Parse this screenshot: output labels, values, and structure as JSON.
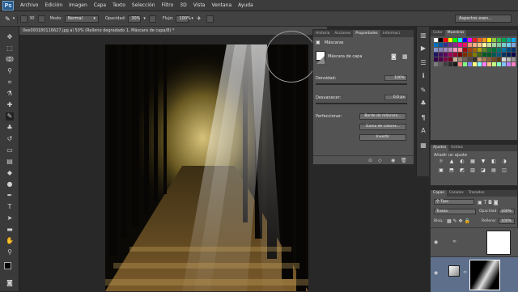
{
  "app": {
    "logo": "Ps"
  },
  "menu": [
    "Archivo",
    "Edición",
    "Imagen",
    "Capa",
    "Texto",
    "Selección",
    "Filtro",
    "3D",
    "Vista",
    "Ventana",
    "Ayuda"
  ],
  "options": {
    "size": "30",
    "mode_label": "Modo:",
    "mode_value": "Normal",
    "opacity_label": "Opacidad:",
    "opacity_value": "30%",
    "flow_label": "Flujo:",
    "flow_value": "100%",
    "workspace": "Aspectos esen..."
  },
  "document": {
    "tab_title": "0ee000180116627.jpg al 50% (Relleno degradado 1, Máscara de capa/8) *"
  },
  "properties": {
    "tabs": [
      "Historia",
      "Acciones",
      "Propiedades",
      "Informaci"
    ],
    "active_tab": 2,
    "section": "Máscaras",
    "mask_label": "Máscara de capa",
    "density_label": "Densidad:",
    "density_value": "100%",
    "feather_label": "Desvanecer:",
    "feather_value": "0,0 px",
    "refine_label": "Perfeccionar:",
    "btn_mask_edge": "Borde de máscara...",
    "btn_color_range": "Gama de colores...",
    "btn_invert": "Invertir"
  },
  "color_panel": {
    "tabs": [
      "Color",
      "Muestras"
    ],
    "active_tab": 1
  },
  "swatch_colors": [
    "#ffffff",
    "#000000",
    "#ff0000",
    "#ffff00",
    "#00ff00",
    "#00ffff",
    "#0000ff",
    "#ff00ff",
    "#ed1c24",
    "#f26522",
    "#f7941d",
    "#fff200",
    "#8dc63f",
    "#39b54a",
    "#00a651",
    "#00a99d",
    "#00aeef",
    "#0072bc",
    "#0054a6",
    "#2e3192",
    "#662d91",
    "#92278f",
    "#ec008c",
    "#ed145b",
    "#f69679",
    "#f9ad81",
    "#fdc68a",
    "#fff799",
    "#c4df9b",
    "#a3d39c",
    "#82ca9c",
    "#7accc8",
    "#6dcff6",
    "#7da7d9",
    "#8393ca",
    "#8781bd",
    "#a187be",
    "#bc8dbf",
    "#f49ac2",
    "#f6989d",
    "#9e0b0f",
    "#a0410d",
    "#a36209",
    "#aba000",
    "#598527",
    "#1a7b30",
    "#007236",
    "#00746b",
    "#0076a3",
    "#004b80",
    "#003471",
    "#1b1464",
    "#440e62",
    "#630460",
    "#9e005d",
    "#9e0039",
    "#790000",
    "#7b2e00",
    "#7d4900",
    "#827b00",
    "#406618",
    "#005e20",
    "#005826",
    "#005952",
    "#005b7f",
    "#003663",
    "#002157",
    "#0d004c",
    "#32004b",
    "#4b0049",
    "#7b0046",
    "#7a0026",
    "#c7b299",
    "#998675",
    "#736357",
    "#534741",
    "#37302d",
    "#c69c6d",
    "#a67c52",
    "#8c6239",
    "#754c24",
    "#603913",
    "#d7d7d7",
    "#b7b7b7",
    "#959595",
    "#7d7d7d",
    "#5e5e5e",
    "#404040",
    "#2b2b2b",
    "#1a1a1a",
    "#ff8080",
    "#80ff80",
    "#8080ff",
    "#ffff80",
    "#80ffff",
    "#ff80ff",
    "#ffc080",
    "#c0ff80",
    "#80ffc0",
    "#80c0ff",
    "#c080ff",
    "#ff80c0"
  ],
  "adjustments": {
    "tabs": [
      "Ajustes",
      "Estilos"
    ],
    "active_tab": 0,
    "subtitle": "Añadir un ajuste",
    "icons": [
      "☼",
      "▲",
      "◐",
      "▦",
      "▼",
      "◧",
      "◑",
      "▣",
      "⬒",
      "◩",
      "▥",
      "◪",
      "▤",
      "◫"
    ]
  },
  "layers": {
    "tabs": [
      "Capas",
      "Canales",
      "Trazados"
    ],
    "active_tab": 0,
    "filter_label": "Tipo",
    "blend_mode": "Trama",
    "opacity_label": "Opacidad:",
    "opacity_value": "100%",
    "lock_label": "Bloq.:",
    "fill_label": "Relleno:",
    "fill_value": "100%"
  }
}
